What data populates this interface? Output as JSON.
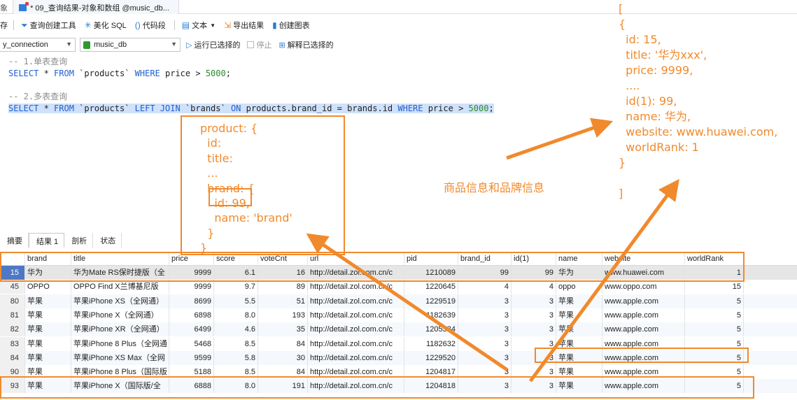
{
  "tabs": {
    "prev_tab": "象",
    "active_tab": "* 09_查询结果-对象和数组 @music_db..."
  },
  "toolbar": {
    "left_cut": "存",
    "items": [
      {
        "icon": "funnel-icon",
        "label": "查询创建工具"
      },
      {
        "icon": "magic-icon",
        "label": "美化 SQL"
      },
      {
        "icon": "parens-icon",
        "label": "代码段"
      },
      {
        "icon": "doc-icon",
        "label": "文本"
      },
      {
        "icon": "export-icon",
        "label": "导出结果"
      },
      {
        "icon": "chart-icon",
        "label": "创建图表"
      }
    ]
  },
  "connbar": {
    "connection": "y_connection",
    "database": "music_db",
    "run_selected": "运行已选择的",
    "stop": "停止",
    "explain_selected": "解释已选择的"
  },
  "editor": {
    "comment1": "-- 1.单表查询",
    "query1": {
      "select": "SELECT",
      "rest1": " * ",
      "from": "FROM",
      "table": " `products` ",
      "where": "WHERE",
      "cond": " price > ",
      "num": "5000",
      "end": ";"
    },
    "comment2": "-- 2.多表查询",
    "query2": {
      "select": "SELECT",
      "rest1": " * ",
      "from": "FROM",
      "table1": " `products` ",
      "left": "LEFT",
      "sp": " ",
      "join": "JOIN",
      "table2": " `brands` ",
      "on": "ON",
      "cond1": " products.brand_id = brands.id ",
      "where": "WHERE",
      "cond2": " price > ",
      "num": "5000",
      "end": ";"
    }
  },
  "result_tabs": [
    "摘要",
    "结果 1",
    "剖析",
    "状态"
  ],
  "grid": {
    "columns": [
      "brand",
      "title",
      "price",
      "score",
      "voteCnt",
      "url",
      "pid",
      "brand_id",
      "id(1)",
      "name",
      "website",
      "worldRank"
    ],
    "rows": [
      [
        "15",
        "华为",
        "华为Mate RS保时捷版（全",
        "9999",
        "6.1",
        "16",
        "http://detail.zol.com.cn/c",
        "1210089",
        "99",
        "99",
        "华为",
        "www.huawei.com",
        "1"
      ],
      [
        "45",
        "OPPO",
        "OPPO Find X兰博基尼版",
        "9999",
        "9.7",
        "89",
        "http://detail.zol.com.cn/c",
        "1220645",
        "4",
        "4",
        "oppo",
        "www.oppo.com",
        "15"
      ],
      [
        "80",
        "苹果",
        "苹果iPhone XS（全网通）",
        "8699",
        "5.5",
        "51",
        "http://detail.zol.com.cn/c",
        "1229519",
        "3",
        "3",
        "苹果",
        "www.apple.com",
        "5"
      ],
      [
        "81",
        "苹果",
        "苹果iPhone X（全网通）",
        "6898",
        "8.0",
        "193",
        "http://detail.zol.com.cn/c",
        "1182639",
        "3",
        "3",
        "苹果",
        "www.apple.com",
        "5"
      ],
      [
        "82",
        "苹果",
        "苹果iPhone XR（全网通）",
        "6499",
        "4.6",
        "35",
        "http://detail.zol.com.cn/c",
        "1205334",
        "3",
        "3",
        "苹果",
        "www.apple.com",
        "5"
      ],
      [
        "83",
        "苹果",
        "苹果iPhone 8 Plus（全网通",
        "5468",
        "8.5",
        "84",
        "http://detail.zol.com.cn/c",
        "1182632",
        "3",
        "3",
        "苹果",
        "www.apple.com",
        "5"
      ],
      [
        "84",
        "苹果",
        "苹果iPhone XS Max（全网",
        "9599",
        "5.8",
        "30",
        "http://detail.zol.com.cn/c",
        "1229520",
        "3",
        "3",
        "苹果",
        "www.apple.com",
        "5"
      ],
      [
        "90",
        "苹果",
        "苹果iPhone 8 Plus（国际版",
        "5188",
        "8.5",
        "84",
        "http://detail.zol.com.cn/c",
        "1204817",
        "3",
        "3",
        "苹果",
        "www.apple.com",
        "5"
      ],
      [
        "93",
        "苹果",
        "苹果iPhone X（国际版/全",
        "6888",
        "8.0",
        "191",
        "http://detail.zol.com.cn/c",
        "1204818",
        "3",
        "3",
        "苹果",
        "www.apple.com",
        "5"
      ]
    ]
  },
  "annotations": {
    "product_box": [
      "product: {",
      "  id:",
      "  title:",
      "  ...",
      "  brand: {",
      "    id: 99,",
      "    name: 'brand'",
      "  }",
      "}"
    ],
    "note": "商品信息和品牌信息",
    "right_json": [
      "[",
      "{",
      "  id: 15,",
      "  title: '华为xxx',",
      "  price: 9999,",
      "  ....",
      "  id(1): 99,",
      "  name: 华为,",
      "  website: www.huawei.com,",
      "  worldRank: 1",
      "}",
      "",
      "]"
    ],
    "color": "#f08a2c"
  }
}
